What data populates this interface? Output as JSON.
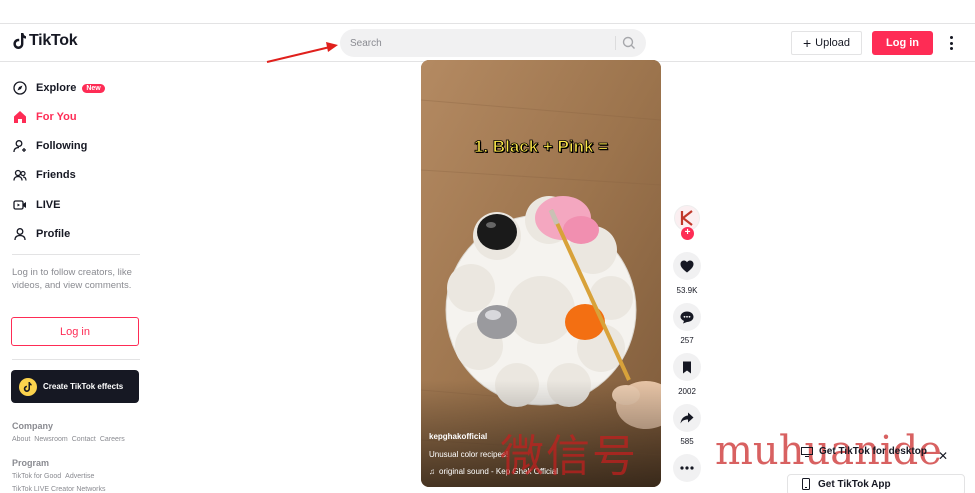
{
  "header": {
    "logo_text": "TikTok",
    "search_placeholder": "Search",
    "upload_label": "Upload",
    "login_label": "Log in"
  },
  "sidebar": {
    "nav": [
      {
        "label": "Explore",
        "icon": "compass-icon",
        "badge": "New"
      },
      {
        "label": "For You",
        "icon": "home-icon",
        "active": true
      },
      {
        "label": "Following",
        "icon": "person-add-icon"
      },
      {
        "label": "Friends",
        "icon": "friends-icon"
      },
      {
        "label": "LIVE",
        "icon": "live-icon"
      },
      {
        "label": "Profile",
        "icon": "person-icon"
      }
    ],
    "login_hint": "Log in to follow creators, like videos, and view comments.",
    "login_button": "Log in",
    "effects_button": "Create TikTok effects",
    "footer": {
      "company_title": "Company",
      "company_links": [
        "About",
        "Newsroom",
        "Contact",
        "Careers"
      ],
      "program_title": "Program",
      "program_links": [
        "TikTok for Good",
        "Advertise"
      ],
      "program_links_2": [
        "TikTok LIVE Creator Networks"
      ]
    }
  },
  "video": {
    "overlay_title": "1. Black + Pink =",
    "username": "kepghakofficial",
    "description": "Unusual color recipes!",
    "sound": "original sound - Kep Ghak Official"
  },
  "actions": {
    "likes": "53.9K",
    "comments": "257",
    "saves": "2002",
    "shares": "585"
  },
  "promo": {
    "desktop": "Get TikTok for desktop",
    "app": "Get TikTok App"
  },
  "watermark": {
    "cn": "微信号",
    "en": "muhuanide"
  },
  "colors": {
    "brand": "#fe2c55",
    "text": "#161823",
    "muted": "#8a8b91"
  }
}
